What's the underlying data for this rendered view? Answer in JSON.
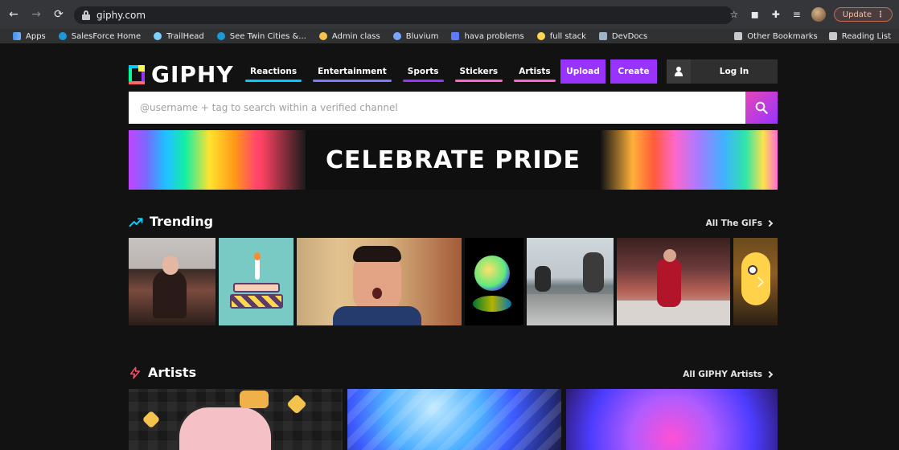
{
  "browser": {
    "url": "giphy.com",
    "update_label": "Update",
    "bookmarks": [
      {
        "label": "Apps",
        "color": "#4a90e2"
      },
      {
        "label": "SalesForce Home",
        "color": "#1a9bd7"
      },
      {
        "label": "TrailHead",
        "color": "#7bd0ff"
      },
      {
        "label": "See Twin Cities &...",
        "color": "#1a9bd7"
      },
      {
        "label": "Admin class",
        "color": "#f7c14c"
      },
      {
        "label": "Bluvium",
        "color": "#7aa6ff"
      },
      {
        "label": "hava problems",
        "color": "#5b7cff"
      },
      {
        "label": "full stack",
        "color": "#ffd84d"
      },
      {
        "label": "DevDocs",
        "color": "#9fb2c7"
      }
    ],
    "bookmarks_right": [
      "Other Bookmarks",
      "Reading List"
    ]
  },
  "site": {
    "logo_text": "GIPHY",
    "nav": [
      {
        "label": "Reactions",
        "underline": "#00ccff"
      },
      {
        "label": "Entertainment",
        "underline": "#7c7bff"
      },
      {
        "label": "Sports",
        "underline": "#9933ff"
      },
      {
        "label": "Stickers",
        "underline": "#ff66cc"
      },
      {
        "label": "Artists",
        "underline": "#ff66cc"
      }
    ],
    "kebab": "⋮",
    "upload_label": "Upload",
    "create_label": "Create",
    "login_label": "Log In",
    "search_placeholder": "@username + tag to search within a verified channel",
    "banner_text": "CELEBRATE PRIDE",
    "trending_title": "Trending",
    "trending_link": "All The GIFs",
    "artists_title": "Artists",
    "artists_link": "All GIPHY Artists"
  },
  "colors": {
    "bg": "#121212",
    "purple": "#9933ff",
    "pink": "#ff66cc",
    "cyan": "#00ccff"
  }
}
